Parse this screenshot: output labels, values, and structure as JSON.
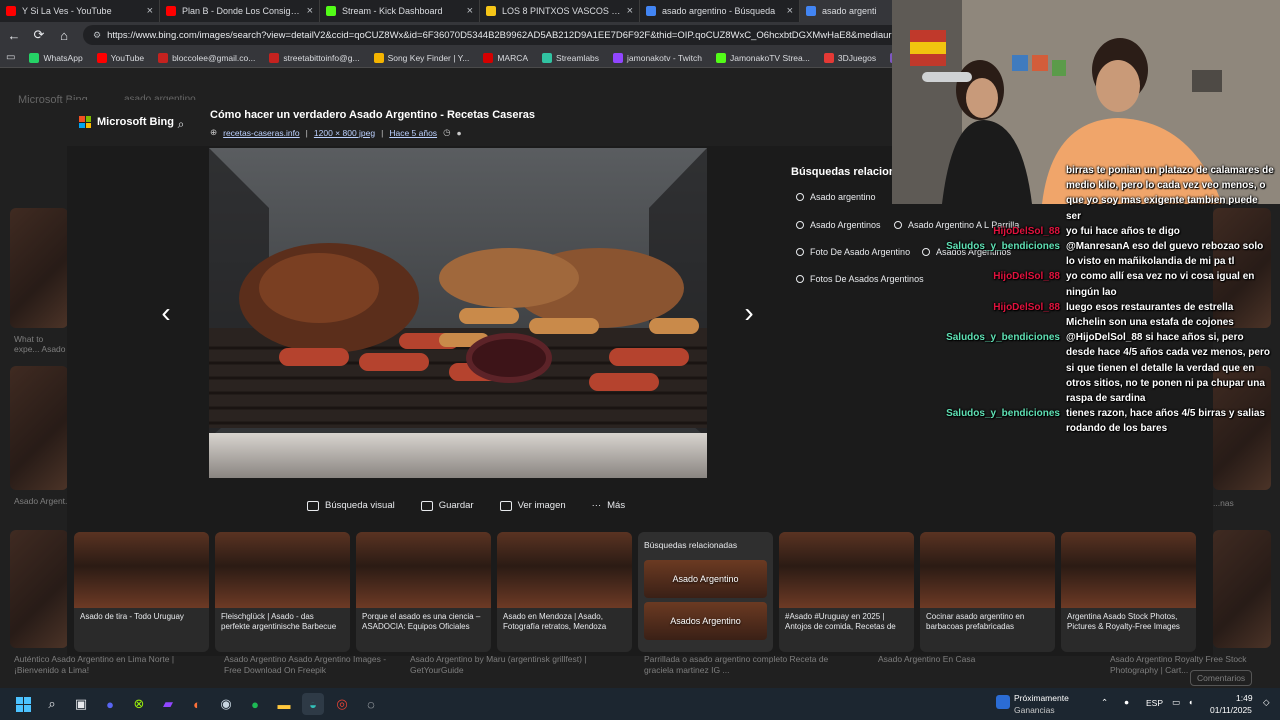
{
  "browser": {
    "tabs": [
      {
        "title": "Y Si La Ves - YouTube",
        "color": "#ff0000",
        "active": false
      },
      {
        "title": "Plan B - Donde Los Consigo? ft. V",
        "color": "#ff0000",
        "active": false
      },
      {
        "title": "Stream - Kick Dashboard",
        "color": "#53fc18",
        "active": false
      },
      {
        "title": "LOS 8 PINTXOS VASCOS MÁS PO",
        "color": "#f5c518",
        "active": false
      },
      {
        "title": "asado argentino - Búsqueda",
        "color": "#4285f4",
        "active": false
      },
      {
        "title": "asado argenti",
        "color": "#4285f4",
        "active": true
      }
    ],
    "url": "https://www.bing.com/images/search?view=detailV2&ccid=qoCUZ8Wx&id=6F36070D5344B2B9962AD5AB212D9A1EE7D6F92F&thid=OIP.qoCUZ8WxC_O6hcxbtDGXMwHaE8&mediaurl=https%",
    "bookmarks": [
      {
        "label": "WhatsApp",
        "color": "#25d366"
      },
      {
        "label": "YouTube",
        "color": "#ff0000"
      },
      {
        "label": "bloccolee@gmail.co...",
        "color": "#c5221f"
      },
      {
        "label": "streetabittoinfo@g...",
        "color": "#c5221f"
      },
      {
        "label": "Song Key Finder | Y...",
        "color": "#f4b400"
      },
      {
        "label": "MARCA",
        "color": "#d50000"
      },
      {
        "label": "Streamlabs",
        "color": "#31c3a2"
      },
      {
        "label": "jamonakotv - Twitch",
        "color": "#9146ff"
      },
      {
        "label": "JamonakoTV Strea...",
        "color": "#53fc18"
      },
      {
        "label": "3DJuegos",
        "color": "#e53935"
      },
      {
        "label": "Nexus Clips",
        "color": "#7e57c2"
      }
    ]
  },
  "background_page": {
    "logo": "Microsoft Bing",
    "query": "asado argentino",
    "captions": [
      "What to expe... Asado",
      "Asado Argent...",
      "Auténtico Asado Argentino en Lima Norte | ¡Bienvenido a Lima!",
      "Asado Argentino Asado Argentino Images - Free Download On Freepik",
      "Asado Argentino by Maru (argentinsk grillfest) | GetYourGuide",
      "Parrillada o asado argentino completo Receta de graciela martinez IG ...",
      "Asado Argentino En Casa",
      "Asado Argentino Royalty Free Stock Photography | Cart...",
      "...nas",
      "Comentarios"
    ]
  },
  "modal": {
    "logo": "Microsoft Bing",
    "title": "Cómo hacer un verdadero Asado Argentino - Recetas Caseras",
    "source": "recetas-caseras.info",
    "size": "1200 × 800 jpeg",
    "age": "Hace 5 años",
    "actions": [
      "Búsqueda visual",
      "Guardar",
      "Ver imagen",
      "Más"
    ],
    "related_title": "Búsquedas relacionadas",
    "related": [
      "Asado argentino",
      "Asado Argentinos",
      "Asado Argentino A L Parrilla",
      "Foto De Asado Argentino",
      "Asados Argentinos",
      "Fotos De Asados Argentinos"
    ],
    "strip": [
      "Asado de tira - Todo Uruguay",
      "Fleischglück | Asado - das perfekte argentinische Barbecue",
      "Porque el asado es una ciencia – ASADOCIA: Equipos Oficiales",
      "Asado en Mendoza | Asado, Fotografía retratos, Mendoza",
      "#Asado #Uruguay en 2025 | Antojos de comida, Recetas de",
      "Cocinar asado argentino en barbacoas prefabricadas",
      "Argentina Asado Stock Photos, Pictures & Royalty-Free Images"
    ],
    "strip_related": {
      "title": "Búsquedas relacionadas",
      "items": [
        "Asado Argentino",
        "Asados Argentino"
      ]
    }
  },
  "chat": [
    {
      "name": "",
      "color": "#ffffff",
      "text": "birras te ponian un platazo de calamares de medio kilo, pero lo cada vez veo menos, o que yo soy mas exigente tambien puede ser"
    },
    {
      "name": "HijoDelSol_88",
      "color": "#e0133e",
      "text": "yo fui hace años te digo"
    },
    {
      "name": "Saludos_y_bendiciones",
      "color": "#5fe0b4",
      "text": "@ManresanA eso del guevo rebozao solo lo visto en mañikolandia de mi pa tl"
    },
    {
      "name": "HijoDelSol_88",
      "color": "#e0133e",
      "text": "yo como allí esa vez no vi cosa igual en ningún lao"
    },
    {
      "name": "HijoDelSol_88",
      "color": "#e0133e",
      "text": "luego esos restaurantes de estrella Michelin son una estafa de cojones"
    },
    {
      "name": "Saludos_y_bendiciones",
      "color": "#5fe0b4",
      "text": "@HijoDelSol_88 si hace años si, pero desde hace 4/5 años cada vez menos, pero si que tienen el detalle la verdad que en otros sitios, no te ponen ni pa chupar una raspa de sardina"
    },
    {
      "name": "Saludos_y_bendiciones",
      "color": "#5fe0b4",
      "text": "tienes razon, hace años 4/5 birras y salias rodando de los bares"
    }
  ],
  "taskbar": {
    "weather_title": "Próximamente",
    "weather_sub": "Ganancias",
    "lang": "ESP",
    "time": "1:49",
    "date": "01/11/2025"
  }
}
